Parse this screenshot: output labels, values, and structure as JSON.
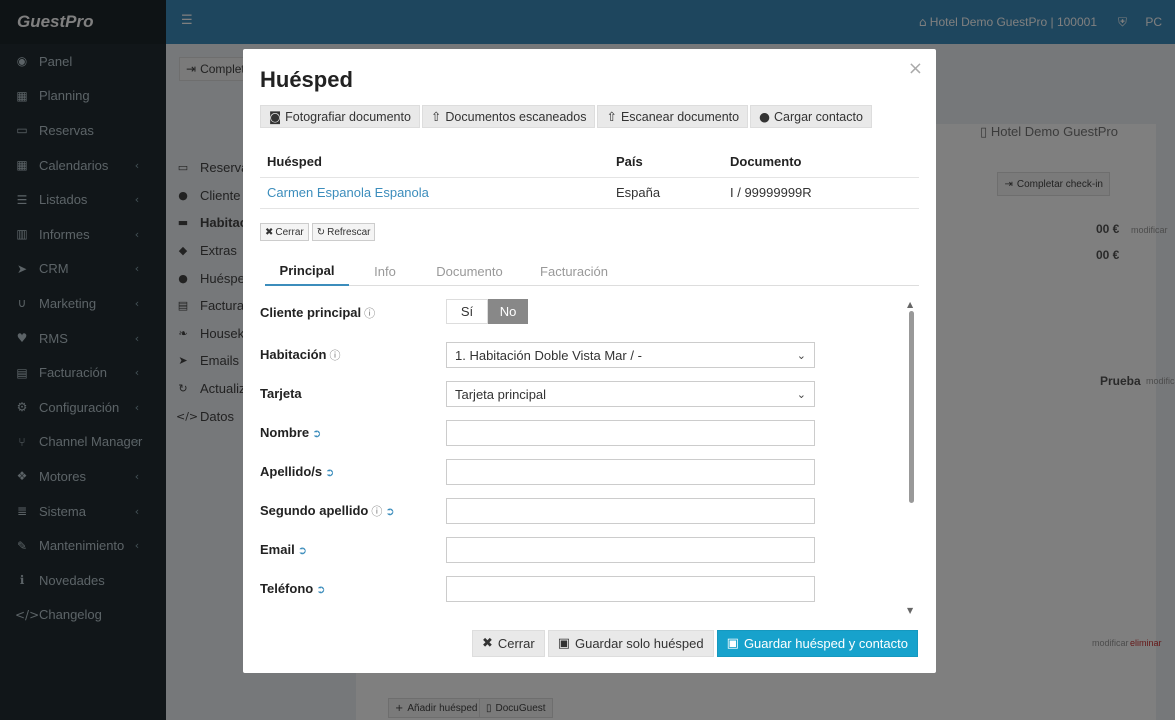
{
  "app": {
    "logo": "GuestPro"
  },
  "sidebar": {
    "items": [
      {
        "label": "Panel",
        "icon": "dashboard-icon",
        "glyph": "◉",
        "has_children": false
      },
      {
        "label": "Planning",
        "icon": "calendar-check-icon",
        "glyph": "▦",
        "has_children": false
      },
      {
        "label": "Reservas",
        "icon": "inbox-icon",
        "glyph": "▭",
        "has_children": false
      },
      {
        "label": "Calendarios",
        "icon": "calendar-icon",
        "glyph": "▦",
        "has_children": true
      },
      {
        "label": "Listados",
        "icon": "list-icon",
        "glyph": "☰",
        "has_children": true
      },
      {
        "label": "Informes",
        "icon": "bar-chart-icon",
        "glyph": "▥",
        "has_children": true
      },
      {
        "label": "CRM",
        "icon": "paper-plane-icon",
        "glyph": "➤",
        "has_children": true
      },
      {
        "label": "Marketing",
        "icon": "magnet-icon",
        "glyph": "∪",
        "has_children": true
      },
      {
        "label": "RMS",
        "icon": "heartbeat-icon",
        "glyph": "♥",
        "has_children": true
      },
      {
        "label": "Facturación",
        "icon": "calculator-icon",
        "glyph": "▤",
        "has_children": true
      },
      {
        "label": "Configuración",
        "icon": "gear-icon",
        "glyph": "⚙",
        "has_children": true
      },
      {
        "label": "Channel Manager",
        "icon": "code-fork-icon",
        "glyph": "⑂",
        "has_children": true
      },
      {
        "label": "Motores",
        "icon": "cubes-icon",
        "glyph": "❖",
        "has_children": true
      },
      {
        "label": "Sistema",
        "icon": "server-icon",
        "glyph": "≣",
        "has_children": true
      },
      {
        "label": "Mantenimiento",
        "icon": "wrench-icon",
        "glyph": "✎",
        "has_children": true
      },
      {
        "label": "Novedades",
        "icon": "info-icon",
        "glyph": "ℹ",
        "has_children": false
      },
      {
        "label": "Changelog",
        "icon": "code-icon",
        "glyph": "</>",
        "has_children": false
      }
    ]
  },
  "topbar": {
    "hotel": "Hotel Demo GuestPro | 100001",
    "user": "PC"
  },
  "background": {
    "complete_btn": "Complet",
    "tabs": [
      {
        "label": "Reserva",
        "glyph": "▭"
      },
      {
        "label": "Cliente",
        "glyph": "●"
      },
      {
        "label": "Habitac",
        "glyph": "▬",
        "active": true
      },
      {
        "label": "Extras",
        "glyph": "◆"
      },
      {
        "label": "Huéspe",
        "glyph": "●"
      },
      {
        "label": "Facturac",
        "glyph": "▤"
      },
      {
        "label": "Housek",
        "glyph": "❧"
      },
      {
        "label": "Emails e",
        "glyph": "➤"
      },
      {
        "label": "Actualiz",
        "glyph": "↻"
      },
      {
        "label": "Datos",
        "glyph": "</>"
      }
    ],
    "hotel_name": "Hotel Demo GuestPro",
    "checkin_btn": "Completar check-in",
    "price1": "00 €",
    "modify1": "modificar",
    "price2": "00 €",
    "prueba": "Prueba",
    "modify2": "modificar",
    "bg_edit": "modificar",
    "bg_delete": "eliminar",
    "add_guest": "Añadir huésped",
    "docuguest": "DocuGuest"
  },
  "modal": {
    "title": "Huésped",
    "close": "×",
    "top_actions": [
      {
        "label": "Fotografiar documento",
        "icon": "camera-icon",
        "glyph": "◙"
      },
      {
        "label": "Documentos escaneados",
        "icon": "upload-icon",
        "glyph": "⇧"
      },
      {
        "label": "Escanear documento",
        "icon": "upload-icon",
        "glyph": "⇧"
      },
      {
        "label": "Cargar contacto",
        "icon": "user-plus-icon",
        "glyph": "●"
      }
    ],
    "table": {
      "headers": [
        "Huésped",
        "País",
        "Documento"
      ],
      "row": {
        "guest": "Carmen Espanola Espanola",
        "country": "España",
        "document": "I / 99999999R"
      }
    },
    "small_actions": [
      {
        "label": "Cerrar",
        "glyph": "✖"
      },
      {
        "label": "Refrescar",
        "glyph": "↻"
      }
    ],
    "tabs": [
      "Principal",
      "Info",
      "Documento",
      "Facturación"
    ],
    "active_tab": "Principal",
    "form": {
      "cliente_principal": {
        "label": "Cliente principal",
        "yes": "Sí",
        "no": "No",
        "selected": "No"
      },
      "habitacion": {
        "label": "Habitación",
        "value": "1. Habitación Doble Vista Mar / -"
      },
      "tarjeta": {
        "label": "Tarjeta",
        "value": "Tarjeta principal"
      },
      "nombre": {
        "label": "Nombre",
        "value": ""
      },
      "apellido": {
        "label": "Apellido/s",
        "value": ""
      },
      "segundo_apellido": {
        "label": "Segundo apellido",
        "value": ""
      },
      "email": {
        "label": "Email",
        "value": ""
      },
      "telefono": {
        "label": "Teléfono",
        "value": ""
      }
    },
    "footer": {
      "cancel": "Cerrar",
      "save_guest": "Guardar solo huésped",
      "save_both": "Guardar huésped y contacto"
    }
  },
  "colors": {
    "sidebar": "#222d32",
    "topbar": "#3c8dbc",
    "primary": "#17a2cc",
    "link": "#3c8dbc"
  }
}
